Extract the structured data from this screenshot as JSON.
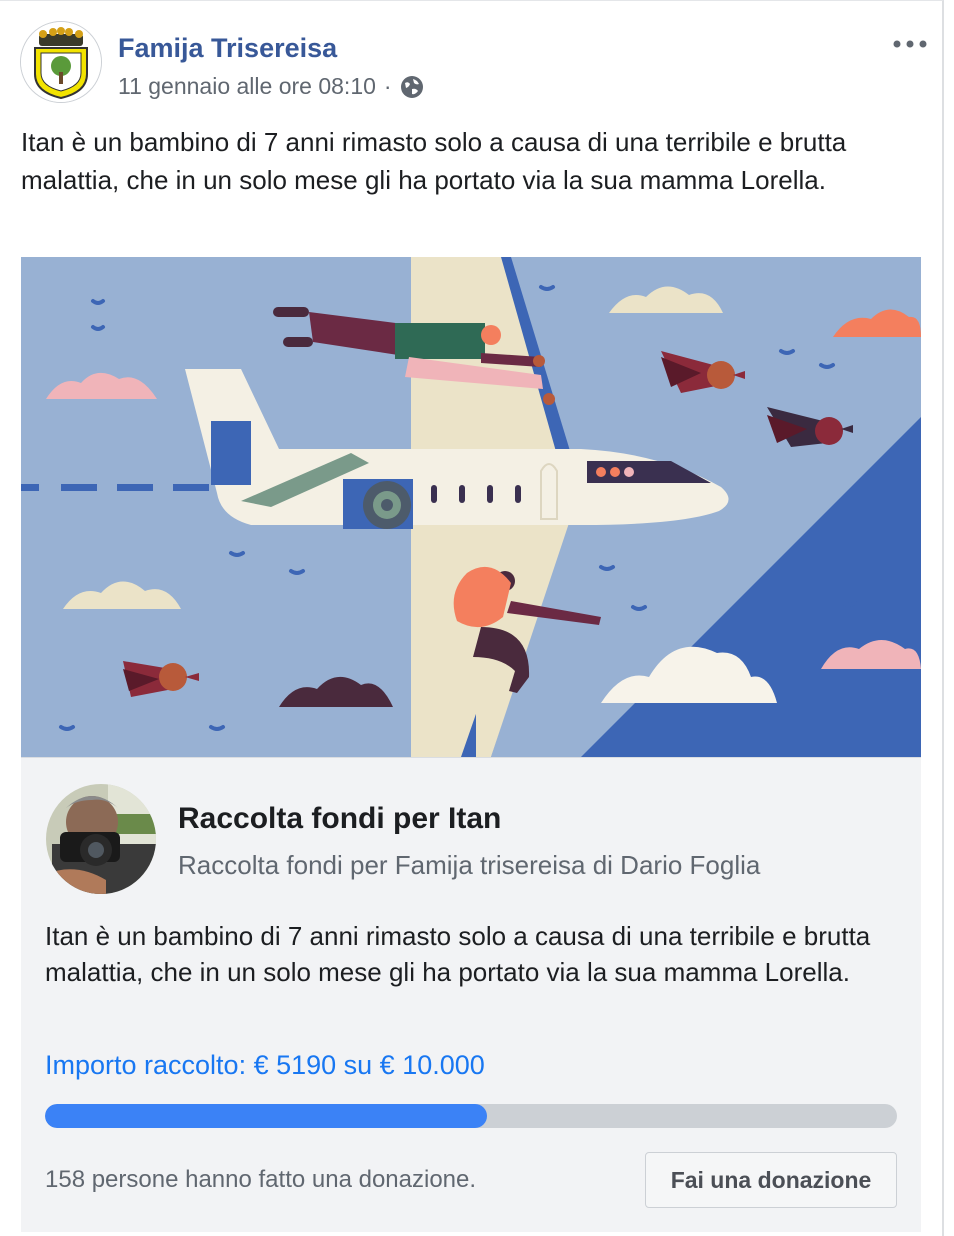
{
  "post": {
    "page_name": "Famija Trisereisa",
    "timestamp": "11 gennaio alle ore 08:10",
    "separator": "·",
    "privacy_icon": "globe-icon",
    "menu_icon": "more-options-icon",
    "text": "Itan è un bambino di 7 anni rimasto solo a causa di una terribile e brutta malattia, che in un solo mese gli ha portato via la sua mamma Lorella."
  },
  "fundraiser": {
    "title": "Raccolta fondi per Itan",
    "subtitle": "Raccolta fondi per Famija trisereisa di Dario Foglia",
    "description": "Itan è un bambino di 7 anni rimasto solo a causa di una terribile e brutta malattia, che in un solo mese gli ha portato via la sua mamma Lorella.",
    "amount_text": "Importo raccolto: € 5190 su € 10.000",
    "progress_fraction": 0.519,
    "donors_text": "158 persone hanno fatto una donazione.",
    "donate_label": "Fai una donazione"
  },
  "colors": {
    "link_blue": "#385898",
    "accent_blue": "#1877f2",
    "progress_fill": "#3b82f6",
    "progress_track": "#ccd0d5",
    "sky": "#98b1d3"
  }
}
